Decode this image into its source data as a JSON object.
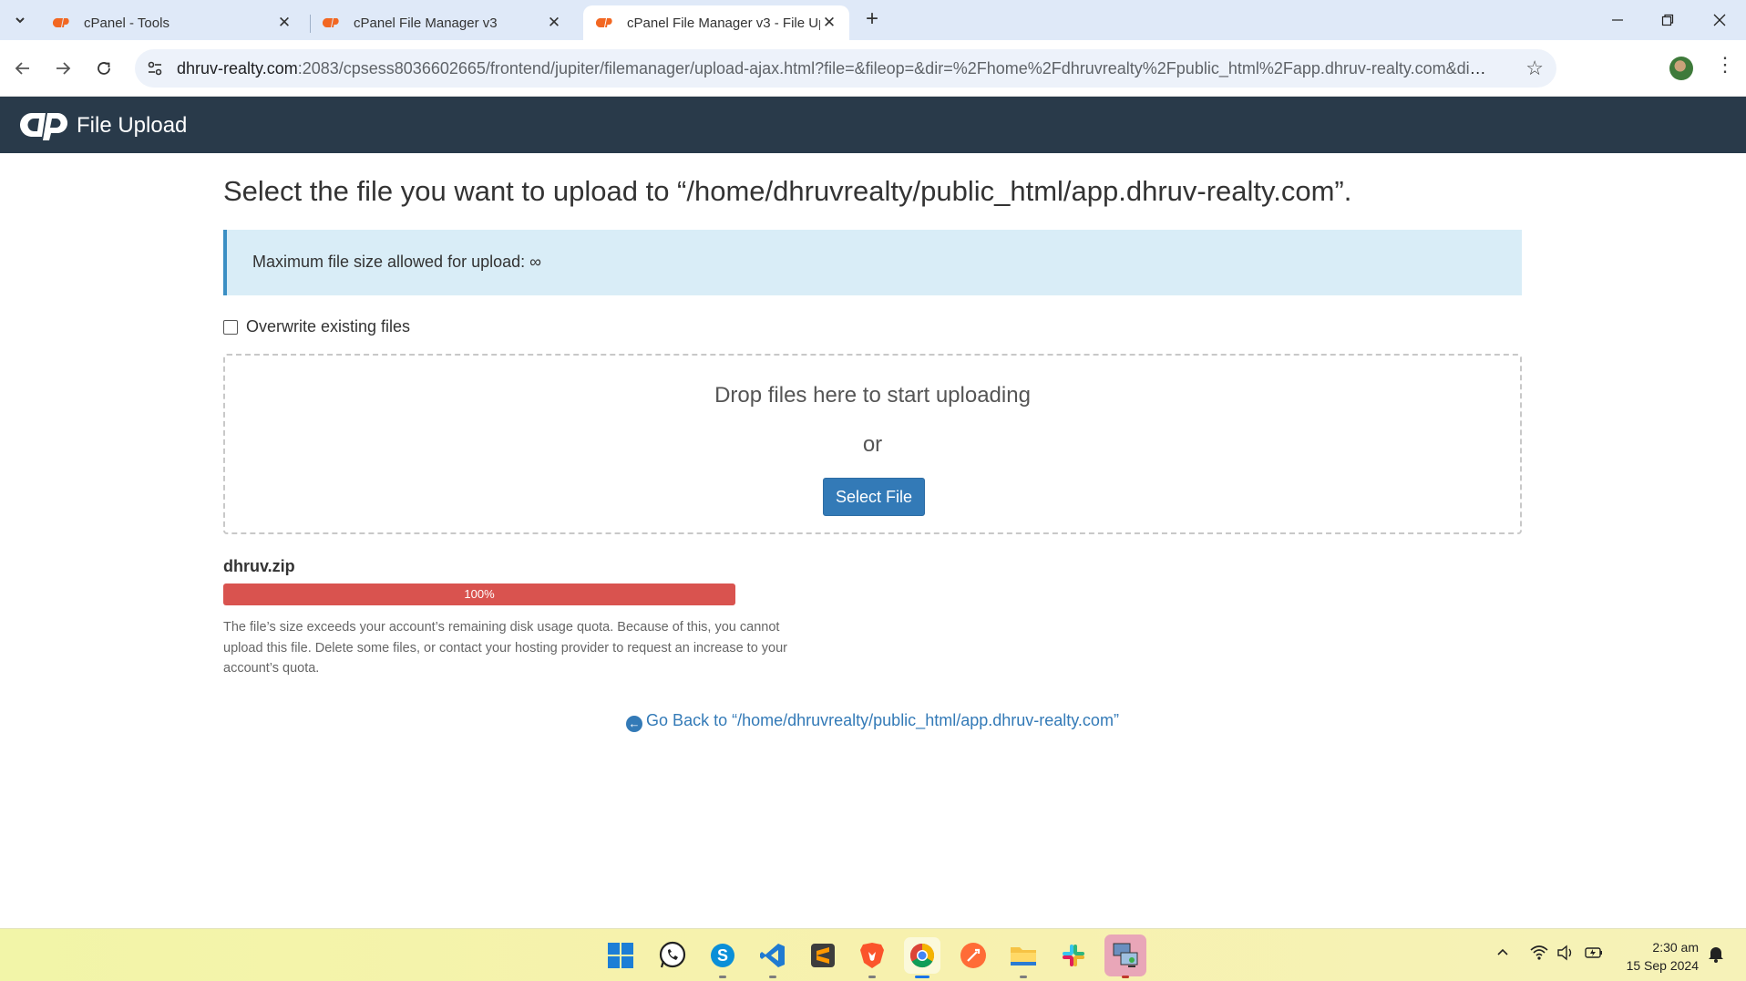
{
  "browser": {
    "tabs": [
      {
        "title": "cPanel - Tools",
        "active": false
      },
      {
        "title": "cPanel File Manager v3",
        "active": false
      },
      {
        "title": "cPanel File Manager v3 - File Up",
        "active": true
      }
    ],
    "url_domain": "dhruv-realty.com",
    "url_rest": ":2083/cpsess8036602665/frontend/jupiter/filemanager/upload-ajax.html?file=&fileop=&dir=%2Fhome%2Fdhruvrealty%2Fpublic_html%2Fapp.dhruv-realty.com&dirop=&char..."
  },
  "header": {
    "title": "File Upload"
  },
  "main": {
    "heading": "Select the file you want to upload to “/home/dhruvrealty/public_html/app.dhruv-realty.com”.",
    "alert_text": "Maximum file size allowed for upload: ∞",
    "overwrite_label": "Overwrite existing files",
    "overwrite_checked": false,
    "drop_text": "Drop files here to start uploading",
    "or_text": "or",
    "select_button": "Select File",
    "upload": {
      "file_name": "dhruv.zip",
      "progress_label": "100%",
      "progress_value": 1.0,
      "status_color": "#d9534f",
      "error_message": "The file’s size exceeds your account’s remaining disk usage quota. Because of this, you cannot upload this file. Delete some files, or contact your hosting provider to request an increase to your account’s quota."
    },
    "go_back": "Go Back to “/home/dhruvrealty/public_html/app.dhruv-realty.com”"
  },
  "taskbar": {
    "apps": [
      "windows-start",
      "whatsapp",
      "skype",
      "vscode",
      "sublime-text",
      "brave",
      "chrome",
      "postman",
      "file-explorer",
      "slack",
      "remote-desktop"
    ],
    "time": "2:30 am",
    "date": "15 Sep 2024"
  },
  "colors": {
    "header_bg": "#293a4a",
    "primary": "#337ab7",
    "danger": "#d9534f",
    "info_bg": "#d9edf7"
  }
}
